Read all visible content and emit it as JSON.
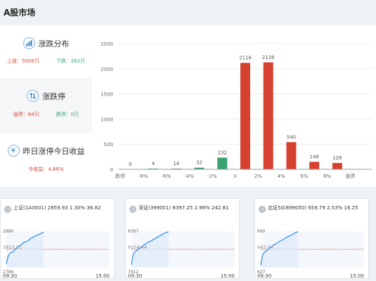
{
  "header": {
    "title": "A股市场"
  },
  "stats": {
    "distribution": {
      "title": "涨跌分布",
      "up": "上涨：5009只",
      "down": "下跌：282只"
    },
    "limits": {
      "title": "涨跌停",
      "limit_up": "涨停：64只",
      "limit_down": "跌停：0只"
    },
    "yesterday": {
      "title": "昨日涨停今日收益",
      "icon_glyph": "¥",
      "yield": "今收益：4.86%"
    }
  },
  "chart_data": {
    "type": "bar",
    "title": "",
    "xlabel": "",
    "ylabel": "",
    "ylim": [
      0,
      2500
    ],
    "yticks": [
      "0",
      "500",
      "1000",
      "1500",
      "2000",
      "2500"
    ],
    "xtick_labels": [
      "跌停",
      "-8%",
      "-6%",
      "-4%",
      "-2%",
      "0",
      "2%",
      "4%",
      "6%",
      "8%",
      "涨停"
    ],
    "categories": [
      "跌停",
      "-8%",
      "-6%",
      "-4%",
      "-2%",
      "0",
      "2%",
      "4%",
      "6%",
      "8%",
      "涨停"
    ],
    "values": [
      0,
      4,
      14,
      32,
      232,
      2116,
      2126,
      540,
      148,
      126
    ],
    "value_labels": [
      "0",
      "4",
      "14",
      "32",
      "232",
      "2116",
      "2126",
      "540",
      "148",
      "126"
    ],
    "colors": [
      "#38a36d",
      "#38a36d",
      "#38a36d",
      "#38a36d",
      "#38a36d",
      "#d7412f",
      "#d7412f",
      "#d7412f",
      "#d7412f",
      "#d7412f"
    ],
    "grid": true
  },
  "indices": [
    {
      "title": "上证(1A0001)  2859.93  1.30%  36.82",
      "y_high": "2880",
      "y_mid": "2823.11",
      "y_low": "2786",
      "time_start": "09:30",
      "time_end": "15:00",
      "series": [
        0.1,
        0.32,
        0.4,
        0.42,
        0.45,
        0.52,
        0.55,
        0.6,
        0.62,
        0.68,
        0.7,
        0.72,
        0.75,
        0.8,
        0.82,
        0.85,
        0.88,
        0.9,
        0.92,
        0.95,
        0.96
      ]
    },
    {
      "title": "深证(399001)  8397.25  2.98%  242.81",
      "y_high": "8397",
      "y_mid": "8154.44",
      "y_low": "7912",
      "time_start": "09:30",
      "time_end": "15:00",
      "series": [
        0.08,
        0.36,
        0.44,
        0.48,
        0.52,
        0.55,
        0.6,
        0.63,
        0.66,
        0.7,
        0.72,
        0.74,
        0.78,
        0.8,
        0.84,
        0.86,
        0.9,
        0.92,
        0.95,
        0.97,
        0.98
      ]
    },
    {
      "title": "北证50(899050)  659.79  2.53%  16.25",
      "y_high": "660",
      "y_mid": "643.54",
      "y_low": "627",
      "time_start": "09:30",
      "time_end": "15:00",
      "series": [
        0.06,
        0.34,
        0.42,
        0.46,
        0.5,
        0.55,
        0.58,
        0.62,
        0.65,
        0.68,
        0.72,
        0.74,
        0.77,
        0.8,
        0.83,
        0.86,
        0.88,
        0.91,
        0.94,
        0.97,
        0.98
      ]
    }
  ]
}
